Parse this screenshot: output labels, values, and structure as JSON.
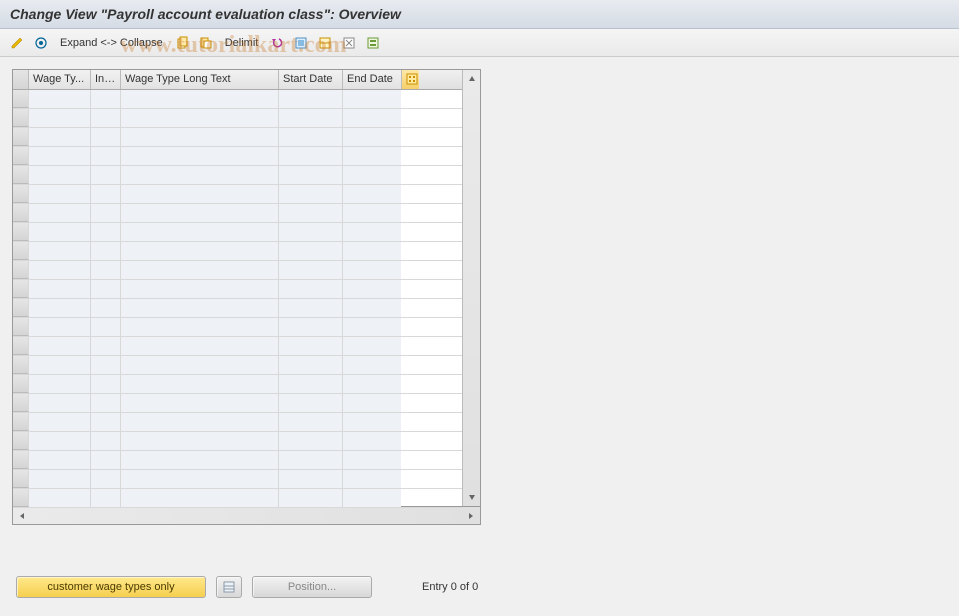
{
  "title": "Change View \"Payroll account evaluation class\": Overview",
  "toolbar": {
    "expand_collapse_label": "Expand <-> Collapse",
    "delimit_label": "Delimit"
  },
  "columns": {
    "wage_type": "Wage Ty...",
    "inf": "Inf...",
    "long_text": "Wage Type Long Text",
    "start_date": "Start Date",
    "end_date": "End Date"
  },
  "rows": [
    {},
    {},
    {},
    {},
    {},
    {},
    {},
    {},
    {},
    {},
    {},
    {},
    {},
    {},
    {},
    {},
    {},
    {},
    {},
    {},
    {},
    {}
  ],
  "footer": {
    "customer_btn": "customer wage types only",
    "position_btn": "Position...",
    "entry_text": "Entry 0 of 0"
  },
  "watermark": "www.tutorialkart.com"
}
